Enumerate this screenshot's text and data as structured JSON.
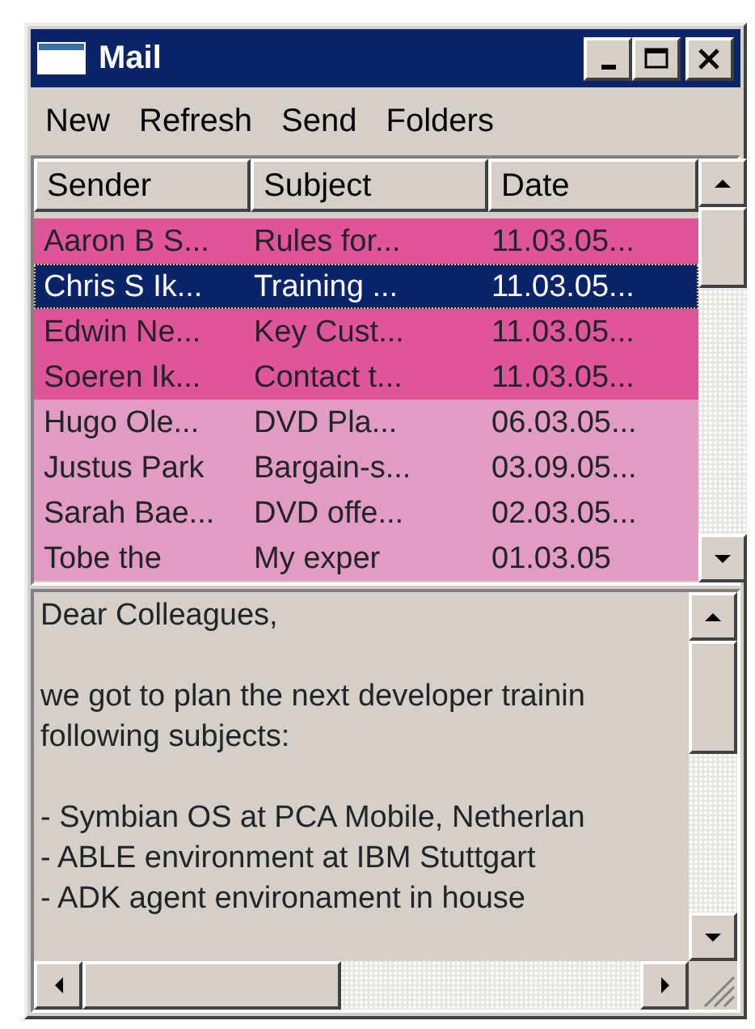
{
  "window": {
    "title": "Mail"
  },
  "menu": [
    {
      "label": "New"
    },
    {
      "label": "Refresh"
    },
    {
      "label": "Send"
    },
    {
      "label": "Folders"
    }
  ],
  "table": {
    "columns": [
      "Sender",
      "Subject",
      "Date"
    ],
    "rows": [
      {
        "cells": [
          "Aaron B S...",
          "Rules for...",
          "11.03.05..."
        ],
        "selected": false,
        "color": "#e0559a"
      },
      {
        "cells": [
          "Chris S Ik...",
          "Training ...",
          "11.03.05..."
        ],
        "selected": true
      },
      {
        "cells": [
          "Edwin Ne...",
          "Key Cust...",
          "11.03.05..."
        ],
        "selected": false,
        "color": "#e0559a"
      },
      {
        "cells": [
          "Soeren Ik...",
          "Contact t...",
          "11.03.05..."
        ],
        "selected": false,
        "color": "#e0559a"
      },
      {
        "cells": [
          "Hugo Ole...",
          "DVD Pla...",
          "06.03.05..."
        ],
        "selected": false,
        "color": "#e29bc2"
      },
      {
        "cells": [
          "Justus Park",
          "Bargain-s...",
          "03.09.05..."
        ],
        "selected": false,
        "color": "#e29bc2"
      },
      {
        "cells": [
          "Sarah Bae...",
          "DVD offe...",
          "02.03.05..."
        ],
        "selected": false,
        "color": "#e29bc2"
      },
      {
        "cells": [
          "Tobe the",
          "My exper",
          "01.03.05"
        ],
        "selected": false,
        "color": "#e29bc2"
      }
    ]
  },
  "message": {
    "paragraphs": [
      [
        "Dear Colleagues,"
      ],
      [
        "we got to plan the next developer trainin",
        "following subjects:"
      ],
      [
        "- Symbian OS at PCA Mobile, Netherlan",
        "- ABLE environment at IBM Stuttgart",
        "- ADK agent environament in house"
      ]
    ]
  }
}
